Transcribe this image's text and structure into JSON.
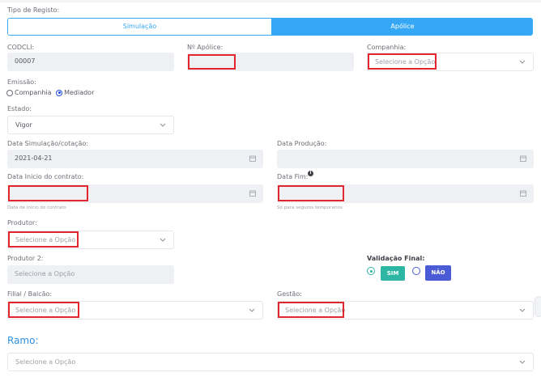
{
  "tipo_registo": {
    "label": "Tipo de Registo:",
    "tab_simulacao": "Simulação",
    "tab_apolice": "Apólice",
    "active_color": "#35a7f5",
    "inactive_color": "#35a7f5"
  },
  "codcli": {
    "label": "CODCLI:",
    "value": "00007"
  },
  "n_apolice": {
    "label": "Nº Apólice:",
    "value": ""
  },
  "companhia": {
    "label": "Companhia:",
    "placeholder": "Selecione a Opção"
  },
  "emissao": {
    "label": "Emissão:",
    "opt_companhia": "Companhia",
    "opt_mediador": "Mediador",
    "selected": "Mediador"
  },
  "estado": {
    "label": "Estado:",
    "value": "Vigor"
  },
  "data_simulacao": {
    "label": "Data Simulação/cotação:",
    "value": "2021-04-21"
  },
  "data_producao": {
    "label": "Data Produção:",
    "value": ""
  },
  "data_inicio": {
    "label": "Data Inicio do contrato:",
    "value": "",
    "hint": "Data de inicio do contrato"
  },
  "data_fim": {
    "label": "Data Fim:",
    "value": "",
    "hint": "Só para seguros temporarios"
  },
  "produtor": {
    "label": "Produtor:",
    "placeholder": "Selecione a Opção"
  },
  "produtor2": {
    "label": "Produtor 2:",
    "placeholder": "Selecione a Opção"
  },
  "validacao": {
    "label": "Validação Final:",
    "sim": "SIM",
    "nao": "NÃO",
    "selected": "SIM",
    "sim_color": "#2db6a3",
    "nao_color": "#4b5bd6"
  },
  "filial": {
    "label": "Filial / Balcão:",
    "placeholder": "Selecione a Opção"
  },
  "gestao": {
    "label": "Gestão:",
    "placeholder": "Selecione a Opção"
  },
  "ramo": {
    "title": "Ramo:",
    "placeholder": "Selecione a Opção",
    "title_color": "#2f8fe0"
  },
  "highlight_color": "#e3262d"
}
